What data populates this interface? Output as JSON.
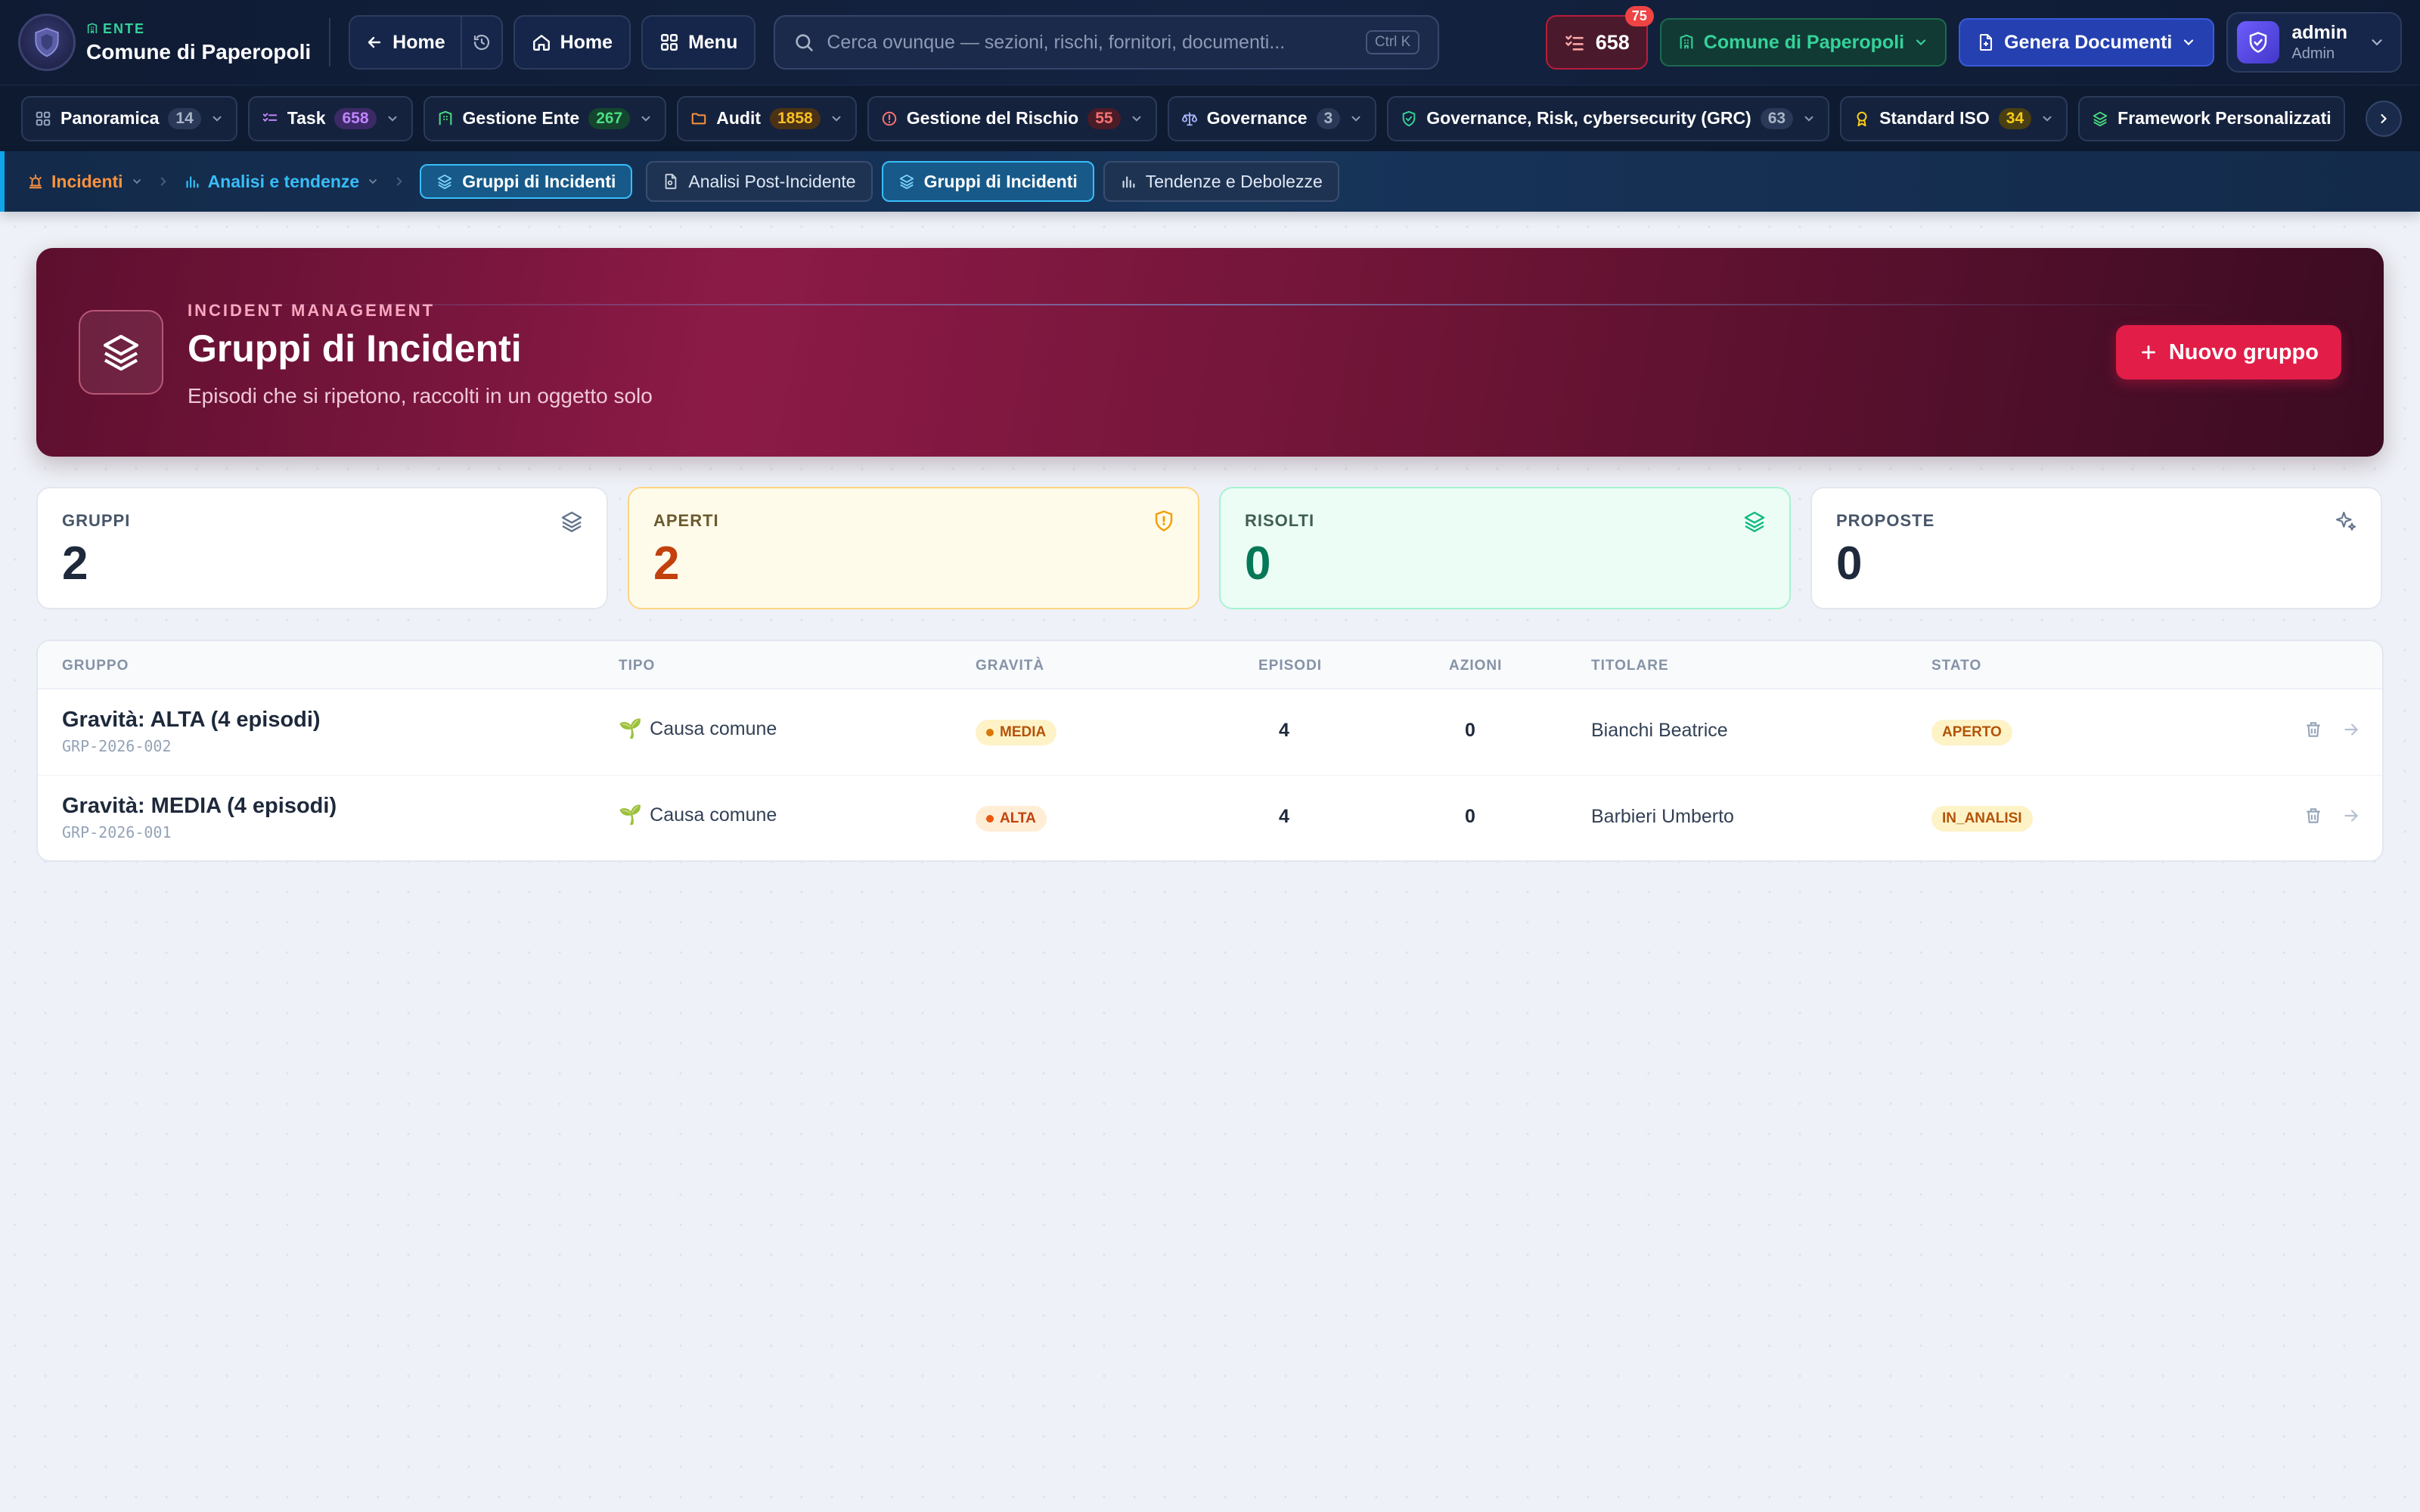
{
  "topbar": {
    "ente_tag": "ENTE",
    "ente_name": "Comune di Paperopoli",
    "back_label": "Home",
    "home_label": "Home",
    "menu_label": "Menu",
    "search_placeholder": "Cerca ovunque — sezioni, rischi, fornitori, documenti...",
    "search_shortcut": "Ctrl K",
    "tasks_count": "658",
    "tasks_badge": "75",
    "comune_label": "Comune di Paperopoli",
    "genera_label": "Genera Documenti",
    "user_name": "admin",
    "user_role": "Admin"
  },
  "modules": [
    {
      "label": "Panoramica",
      "count": "14",
      "icon": "grid-icon",
      "color": "#94a3b8"
    },
    {
      "label": "Task",
      "count": "658",
      "icon": "checklist-icon",
      "color": "#a855f7"
    },
    {
      "label": "Gestione Ente",
      "count": "267",
      "icon": "building-icon",
      "color": "#22c55e"
    },
    {
      "label": "Audit",
      "count": "1858",
      "icon": "folder-icon",
      "color": "#f59e0b"
    },
    {
      "label": "Gestione del Rischio",
      "count": "55",
      "icon": "alert-circle-icon",
      "color": "#ef4444"
    },
    {
      "label": "Governance",
      "count": "3",
      "icon": "scale-icon",
      "color": "#94a3b8"
    },
    {
      "label": "Governance, Risk, cybersecurity (GRC)",
      "count": "63",
      "icon": "shield-check-icon",
      "color": "#94a3b8"
    },
    {
      "label": "Standard ISO",
      "count": "34",
      "icon": "award-icon",
      "color": "#eab308"
    },
    {
      "label": "Framework Personalizzati",
      "count": "",
      "icon": "layers-icon",
      "color": "#22c55e"
    }
  ],
  "subnav": {
    "crumb_incidenti": "Incidenti",
    "crumb_analisi": "Analisi e tendenze",
    "chips": [
      "Gruppi di Incidenti",
      "Analisi Post-Incidente",
      "Gruppi di Incidenti",
      "Tendenze e Debolezze"
    ]
  },
  "hero": {
    "tag": "INCIDENT MANAGEMENT",
    "title": "Gruppi di Incidenti",
    "subtitle": "Episodi che si ripetono, raccolti in un oggetto solo",
    "button": "Nuovo gruppo"
  },
  "stats": [
    {
      "label": "GRUPPI",
      "value": "2",
      "icon": "layers-icon"
    },
    {
      "label": "APERTI",
      "value": "2",
      "icon": "shield-alert-icon"
    },
    {
      "label": "RISOLTI",
      "value": "0",
      "icon": "layers-icon"
    },
    {
      "label": "PROPOSTE",
      "value": "0",
      "icon": "sparkles-icon"
    }
  ],
  "table": {
    "headers": [
      "GRUPPO",
      "TIPO",
      "GRAVITÀ",
      "EPISODI",
      "AZIONI",
      "TITOLARE",
      "STATO"
    ],
    "rows": [
      {
        "name": "Gravità: ALTA (4 episodi)",
        "code": "GRP-2026-002",
        "tipo": "Causa comune",
        "gravita": "MEDIA",
        "episodi": "4",
        "azioni": "0",
        "titolare": "Bianchi Beatrice",
        "stato": "APERTO"
      },
      {
        "name": "Gravità: MEDIA (4 episodi)",
        "code": "GRP-2026-001",
        "tipo": "Causa comune",
        "gravita": "ALTA",
        "episodi": "4",
        "azioni": "0",
        "titolare": "Barbieri Umberto",
        "stato": "IN_ANALISI"
      }
    ]
  }
}
